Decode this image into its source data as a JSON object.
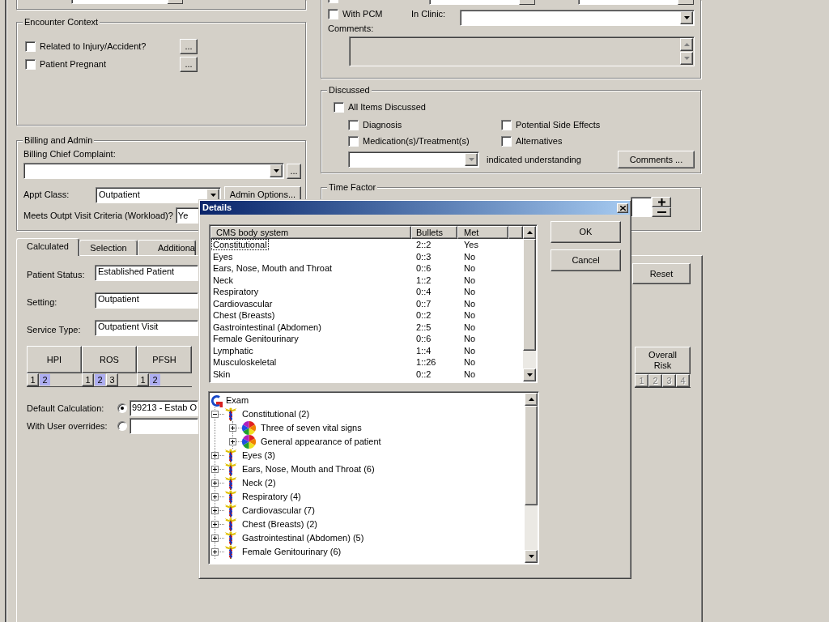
{
  "encounter_context": {
    "title": "Encounter Context",
    "items": [
      {
        "label": "Related to Injury/Accident?",
        "checked": false,
        "button": "..."
      },
      {
        "label": "Patient Pregnant",
        "checked": false,
        "button": "..."
      }
    ]
  },
  "billing_and_admin": {
    "title": "Billing and Admin",
    "chief_complaint_label": "Billing Chief Complaint:",
    "chief_complaint_button": "...",
    "appt_class_label": "Appt Class:",
    "appt_class": "Outpatient",
    "admin_options_button": "Admin Options...",
    "workload_label": "Meets Outpt Visit Criteria (Workload)?",
    "workload": "Ye"
  },
  "clinic": {
    "checkbox_1": {
      "checked": false
    },
    "with_pcm": {
      "label": "With PCM",
      "checked": false
    },
    "in_clinic_label": "In Clinic:",
    "comments_label": "Comments:",
    "comments_box": {
      "disabled": true
    }
  },
  "discussed": {
    "title": "Discussed",
    "all_items": {
      "label": "All Items Discussed",
      "checked": false
    },
    "items": [
      {
        "label": "Diagnosis",
        "checked": false
      },
      {
        "label": "Potential Side Effects",
        "checked": false
      },
      {
        "label": "Medication(s)/Treatment(s)",
        "checked": false
      },
      {
        "label": "Alternatives",
        "checked": false
      }
    ],
    "understanding_dropdown": {
      "disabled": true
    },
    "understanding_label": "indicated understanding",
    "comments_button": "Comments ..."
  },
  "time_factor": {
    "title": "Time Factor"
  },
  "tabs": [
    {
      "label": "Calculated",
      "selected": true
    },
    {
      "label": "Selection",
      "selected": false
    },
    {
      "label": "Additiona",
      "selected": false
    }
  ],
  "calculated": {
    "fields": [
      {
        "label": "Patient Status:",
        "value": "Established Patient"
      },
      {
        "label": "Setting:",
        "value": "Outpatient"
      },
      {
        "label": "Service Type:",
        "value": "Outpatient Visit"
      }
    ],
    "components": [
      {
        "name": "HPI",
        "levels": [
          {
            "label": "1",
            "selected": false
          },
          {
            "label": "2",
            "selected": true
          }
        ]
      },
      {
        "name": "ROS",
        "levels": [
          {
            "label": "1",
            "selected": false
          },
          {
            "label": "2",
            "selected": true
          },
          {
            "label": "3",
            "selected": false
          }
        ]
      },
      {
        "name": "PFSH",
        "levels": [
          {
            "label": "1",
            "selected": false
          },
          {
            "label": "2",
            "selected": true
          }
        ]
      }
    ],
    "calculation_options": [
      {
        "label": "Default Calculation:",
        "selected": true,
        "value": "99213 - Estab O"
      },
      {
        "label": "With User overrides:",
        "selected": false
      }
    ],
    "reset_button": "Reset",
    "overall_risk": {
      "name": "Overall Risk",
      "disabled": true,
      "levels": [
        {
          "label": "1",
          "selected": false
        },
        {
          "label": "2",
          "selected": false
        },
        {
          "label": "3",
          "selected": false
        },
        {
          "label": "4",
          "selected": false
        }
      ]
    }
  },
  "dialog": {
    "title": "Details",
    "columns": [
      "CMS body system",
      "Bullets",
      "Met"
    ],
    "rows": [
      {
        "system": "Constitutional",
        "bullets": "2::2",
        "met": "Yes",
        "focused": true
      },
      {
        "system": "Eyes",
        "bullets": "0::3",
        "met": "No",
        "focused": false
      },
      {
        "system": "Ears, Nose, Mouth and Throat",
        "bullets": "0::6",
        "met": "No",
        "focused": false
      },
      {
        "system": "Neck",
        "bullets": "1::2",
        "met": "No",
        "focused": false
      },
      {
        "system": "Respiratory",
        "bullets": "0::4",
        "met": "No",
        "focused": false
      },
      {
        "system": "Cardiovascular",
        "bullets": "0::7",
        "met": "No",
        "focused": false
      },
      {
        "system": "Chest (Breasts)",
        "bullets": "0::2",
        "met": "No",
        "focused": false
      },
      {
        "system": "Gastrointestinal (Abdomen)",
        "bullets": "2::5",
        "met": "No",
        "focused": false
      },
      {
        "system": "Female Genitourinary",
        "bullets": "0::6",
        "met": "No",
        "focused": false
      },
      {
        "system": "Lymphatic",
        "bullets": "1::4",
        "met": "No",
        "focused": false
      },
      {
        "system": "Musculoskeletal",
        "bullets": "1::26",
        "met": "No",
        "focused": false
      },
      {
        "system": "Skin",
        "bullets": "0::2",
        "met": "No",
        "focused": false
      }
    ],
    "buttons": [
      "OK",
      "Cancel"
    ],
    "tree": {
      "label": "Exam",
      "children": [
        {
          "label": "Constitutional (2)",
          "expanded": true,
          "children": [
            {
              "label": "Three of seven vital signs",
              "expanded": false
            },
            {
              "label": "General appearance of patient",
              "expanded": false
            }
          ]
        },
        {
          "label": "Eyes (3)",
          "expanded": false
        },
        {
          "label": "Ears, Nose, Mouth and Throat (6)",
          "expanded": false
        },
        {
          "label": "Neck (2)",
          "expanded": false
        },
        {
          "label": "Respiratory (4)",
          "expanded": false
        },
        {
          "label": "Cardiovascular (7)",
          "expanded": false
        },
        {
          "label": "Chest (Breasts) (2)",
          "expanded": false
        },
        {
          "label": "Gastrointestinal (Abdomen) (5)",
          "expanded": false
        },
        {
          "label": "Female Genitourinary (6)",
          "expanded": false
        }
      ]
    }
  }
}
